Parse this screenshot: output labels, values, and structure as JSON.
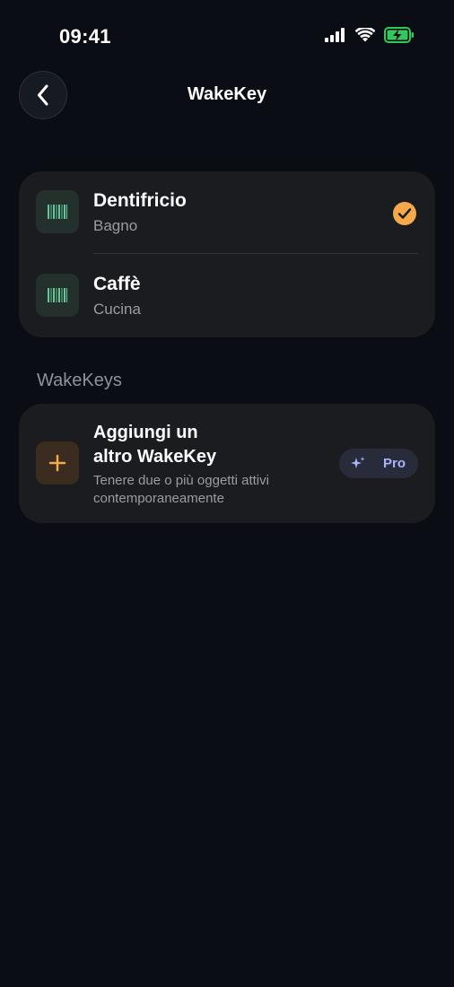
{
  "status_bar": {
    "time": "09:41",
    "icons": [
      "signal-icon",
      "wifi-icon",
      "battery-charging-icon"
    ],
    "battery_color": "#34c759"
  },
  "header": {
    "back_icon": "chevron-left-icon",
    "title": "WakeKey"
  },
  "items": [
    {
      "title": "Dentifricio",
      "subtitle": "Bagno",
      "icon": "barcode-icon",
      "selected": true
    },
    {
      "title": "Caffè",
      "subtitle": "Cucina",
      "icon": "barcode-icon",
      "selected": false
    }
  ],
  "section": {
    "label": "WakeKeys"
  },
  "add_card": {
    "title_line1": "Aggiungi un",
    "title_line2": "altro WakeKey",
    "subtitle_line1": "Tenere due o più oggetti attivi",
    "subtitle_line2": "contemporaneamente",
    "icon": "plus-icon",
    "badge_label": "Pro",
    "badge_icon": "sparkle-icon"
  },
  "colors": {
    "background": "#0a0d14",
    "card": "#1b1c20",
    "accent_orange": "#f5a94a",
    "barcode_green": "#5fc79a",
    "pro_text": "#a9b3ff"
  }
}
